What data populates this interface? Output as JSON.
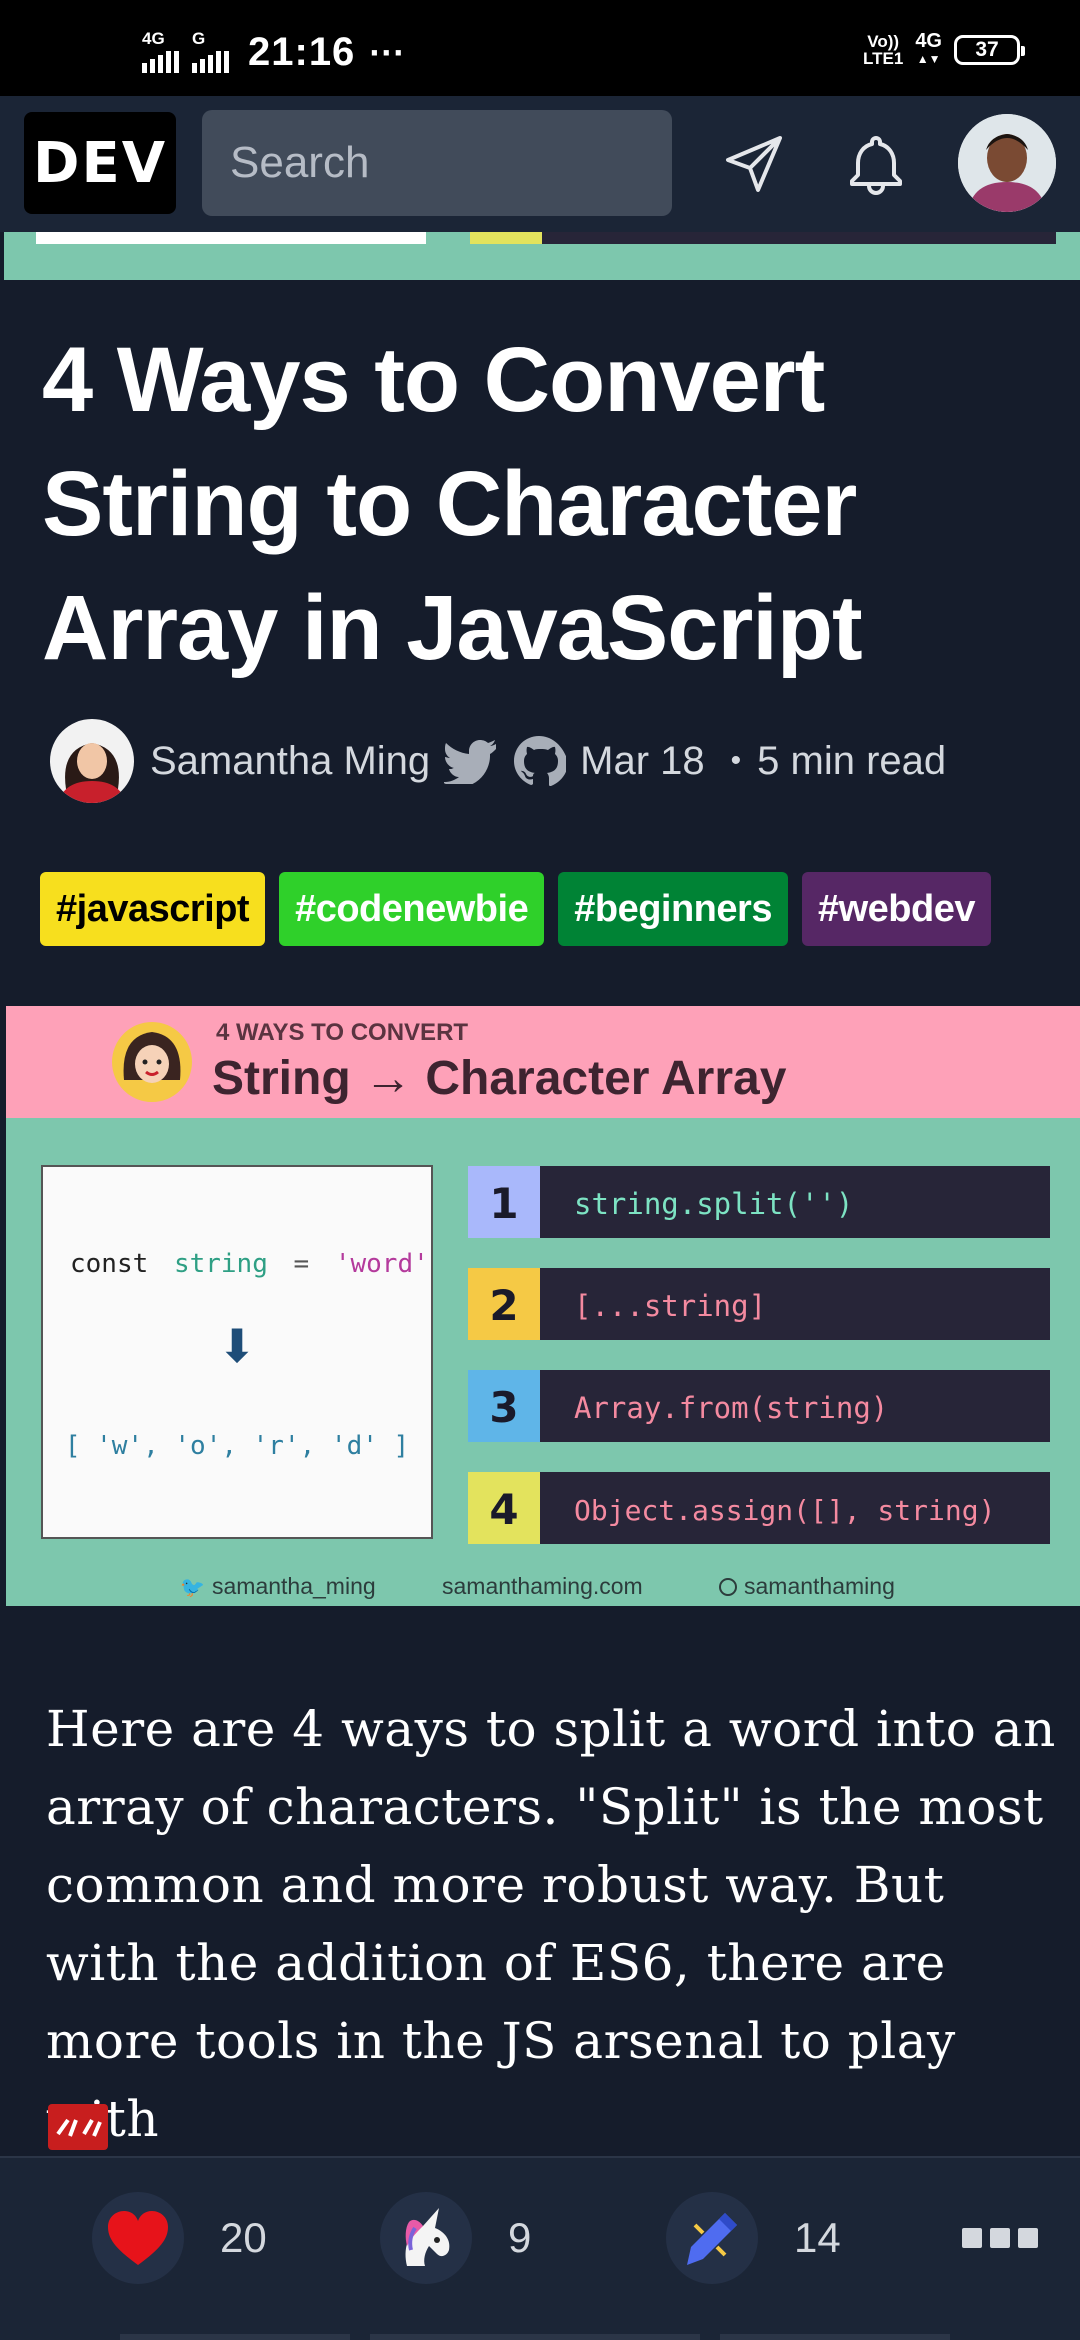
{
  "status_bar": {
    "net1": "4G",
    "net2": "G",
    "time": "21:16",
    "dots": "···",
    "volte_top": "Vo))",
    "volte_bottom": "LTE1",
    "net_right": "4G",
    "battery": "37"
  },
  "header": {
    "logo": "DEV",
    "search_placeholder": "Search"
  },
  "article": {
    "title": "4 Ways to Convert String to Character Array in JavaScript",
    "author": "Samantha Ming",
    "date": "Mar 18",
    "separator": "•",
    "read_time": "5 min read",
    "tags": [
      {
        "label": "#javascript",
        "bg": "#f7df1e",
        "fg": "#000000"
      },
      {
        "label": "#codenewbie",
        "bg": "#2fd02a",
        "fg": "#ffffff"
      },
      {
        "label": "#beginners",
        "bg": "#008335",
        "fg": "#ffffff"
      },
      {
        "label": "#webdev",
        "bg": "#562765",
        "fg": "#ffffff"
      }
    ],
    "body": "Here are 4 ways to split a word into an array of characters. \"Split\" is the most common and more robust way. But with the addition of ES6, there are more tools in the JS arsenal to play with"
  },
  "cover": {
    "kicker": "4 WAYS TO CONVERT",
    "heading": "String → Character Array",
    "code_const": "const",
    "code_var": "string",
    "code_eq": "=",
    "code_val": "'word'",
    "arrow": "⬇",
    "result": "[ 'w', 'o', 'r', 'd' ]",
    "methods": [
      {
        "num": "1",
        "code": "string.split('')"
      },
      {
        "num": "2",
        "code": "[...string]"
      },
      {
        "num": "3",
        "code": "Array.from(string)"
      },
      {
        "num": "4",
        "code": "Object.assign([], string)"
      }
    ],
    "footer_twitter": "samantha_ming",
    "footer_site": "samanthaming.com",
    "footer_insta": "samanthaming",
    "colors": {
      "bg_green": "#7dc7ad",
      "bg_pink": "#fea1b8",
      "num1": "#a9b8fb",
      "num2": "#f5c945",
      "num3": "#5fb5e8",
      "num4": "#e3e35d"
    }
  },
  "reactions": {
    "hearts": "20",
    "unicorns": "9",
    "bookmarks": "14"
  },
  "colors": {
    "page_bg": "#151c2b",
    "header_bg": "#1b2536",
    "search_bg": "#414b5a"
  }
}
